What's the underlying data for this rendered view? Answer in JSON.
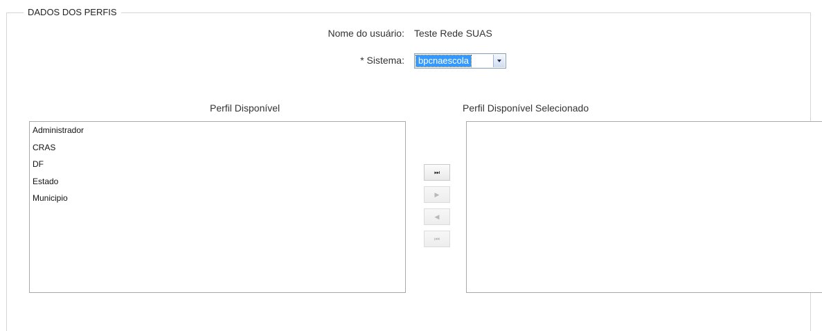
{
  "section": {
    "legend": "DADOS DOS PERFIS"
  },
  "user": {
    "label": "Nome do usuário:",
    "value": "Teste Rede SUAS"
  },
  "system": {
    "label": "* Sistema:",
    "selected": "bpcnaescola"
  },
  "available": {
    "title": "Perfil Disponível",
    "items": [
      "Administrador",
      "CRAS",
      "DF",
      "Estado",
      "Municipio"
    ]
  },
  "selected_list": {
    "title": "Perfil Disponível Selecionado",
    "items": []
  },
  "buttons": {
    "move_all_right": {
      "glyph": "⏭",
      "icon": "fast-forward-icon"
    },
    "move_right": {
      "glyph": "▶",
      "icon": "play-icon"
    },
    "move_left": {
      "glyph": "◀",
      "icon": "back-icon"
    },
    "move_all_left": {
      "glyph": "⏮",
      "icon": "rewind-icon"
    }
  }
}
